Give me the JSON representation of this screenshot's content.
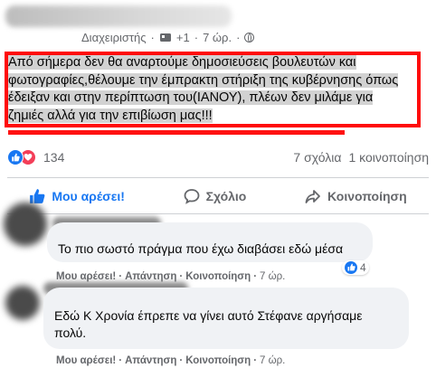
{
  "post": {
    "author_role": "Διαχειριστής",
    "time": "7 ώρ.",
    "plus_count": "+1",
    "text_lines": [
      "Από σήμερα δεν θα αναρτούμε δημοσιεύσεις βουλευτών και",
      "φωτογραφίες,θέλουμε την έμπρακτη στήριξη της κυβέρνησης όπως",
      "έδειξαν και στην περίπτωση του(ΙΑΝΟΥ), πλέων δεν μιλάμε για",
      "ζημιές αλλά για την επιβίωση μας!!!"
    ],
    "reaction_count": "134",
    "comments_count": "7 σχόλια",
    "shares_count": "1 κοινοποίηση"
  },
  "actions": {
    "like": "Μου αρέσει!",
    "comment": "Σχόλιο",
    "share": "Κοινοποίηση"
  },
  "comments": [
    {
      "text": "Το πιο σωστό πράγμα που έχω διαβάσει εδώ μέσα",
      "like": "Μου αρέσει!",
      "reply": "Απάντηση",
      "share": "Κοινοποίηση",
      "time": "7 ώρ.",
      "reactions": "4"
    },
    {
      "text_lines": [
        "Εδώ Κ Χρονία έπρεπε να γίνει αυτό Στέφανε αργήσαμε",
        "πολύ."
      ],
      "like": "Μου αρέσει!",
      "reply": "Απάντηση",
      "share": "Κοινοποίηση",
      "time": "7 ώρ."
    }
  ],
  "colors": {
    "accent": "#1877f2",
    "highlight_box": "#ff0a0a",
    "love": "#f33e58"
  }
}
